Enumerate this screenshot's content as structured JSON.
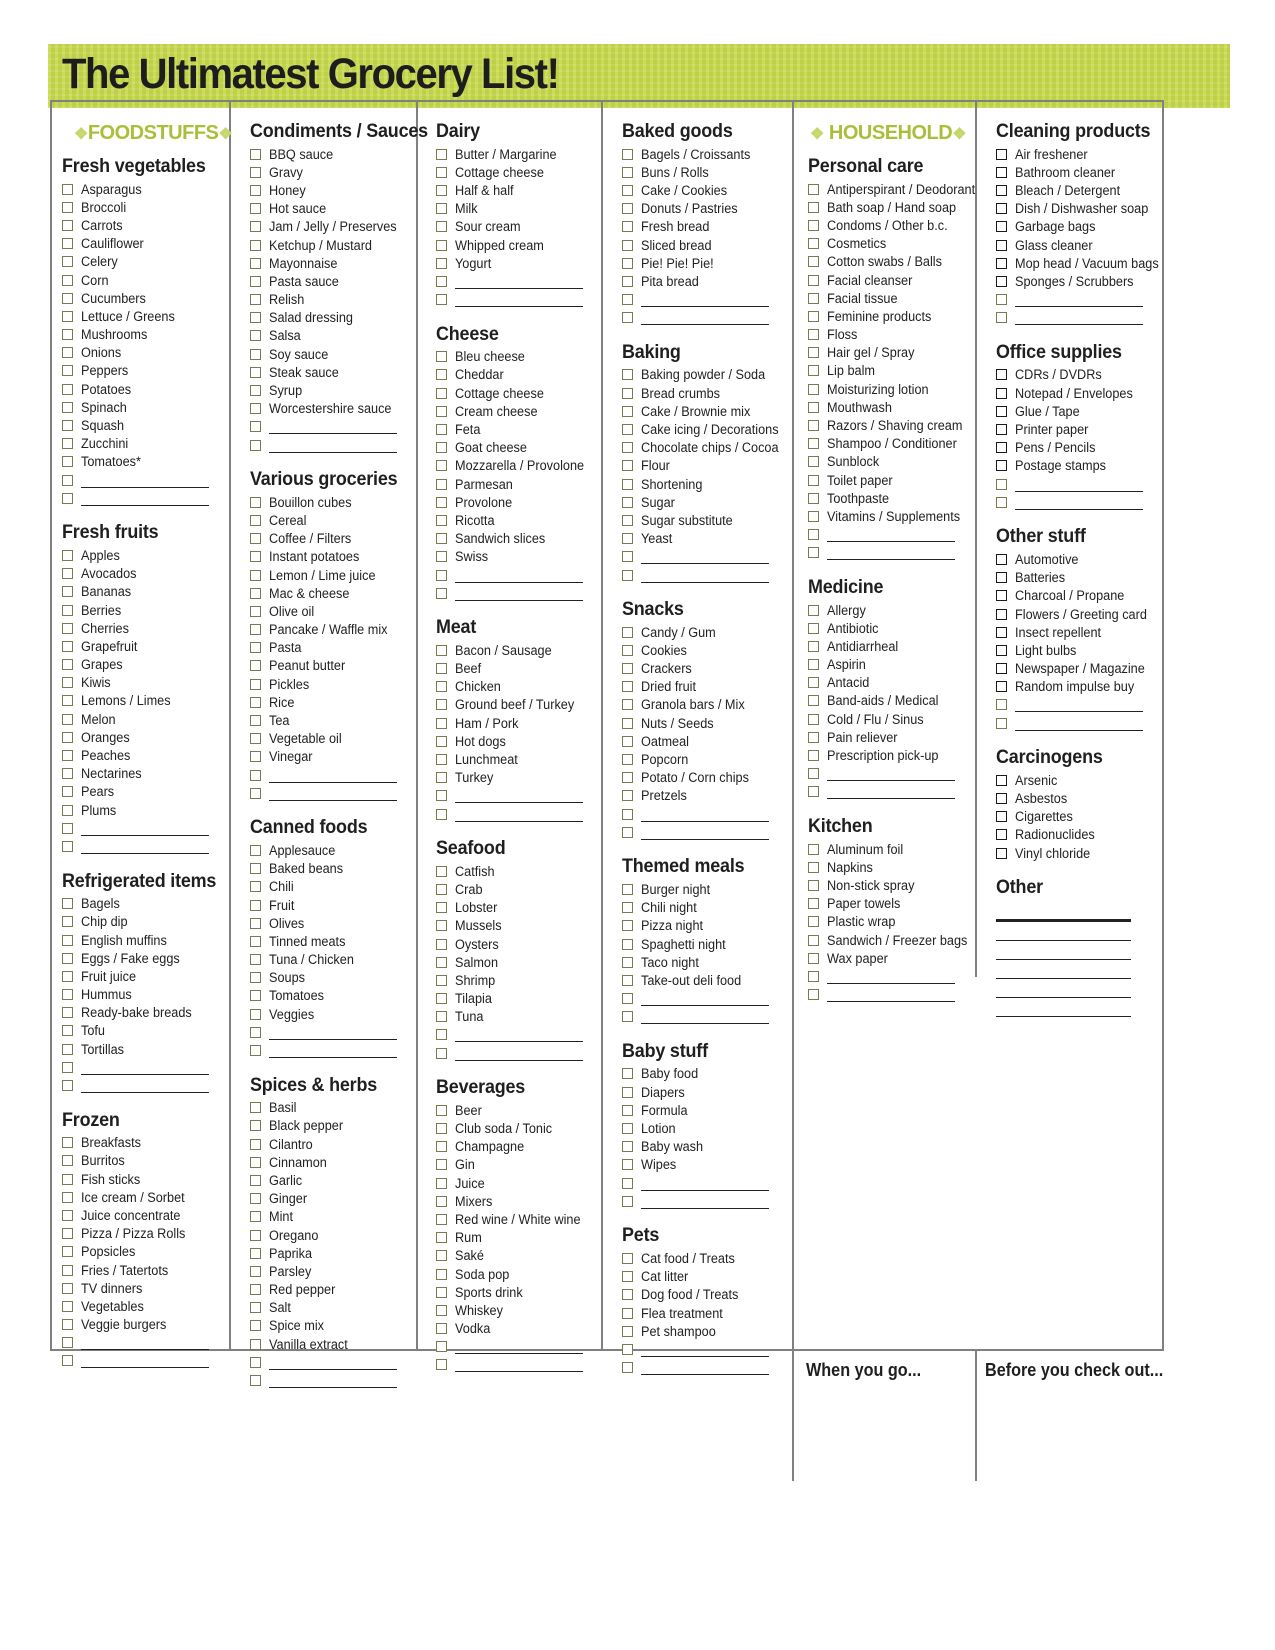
{
  "title": "The Ultimatest Grocery List!",
  "colors": {
    "accent": "#c5d84a",
    "brand_text": "#a9bf39",
    "rule": "#808080"
  },
  "foodstuffs": {
    "brand": "FOODSTUFFS",
    "ornament": "❖",
    "col1": [
      {
        "title": "Fresh vegetables",
        "items": [
          "Asparagus",
          "Broccoli",
          "Carrots",
          "Cauliflower",
          "Celery",
          "Corn",
          "Cucumbers",
          "Lettuce / Greens",
          "Mushrooms",
          "Onions",
          "Peppers",
          "Potatoes",
          "Spinach",
          "Squash",
          "Zucchini",
          "Tomatoes*"
        ],
        "blanks": 2
      },
      {
        "title": "Fresh fruits",
        "items": [
          "Apples",
          "Avocados",
          "Bananas",
          "Berries",
          "Cherries",
          "Grapefruit",
          "Grapes",
          "Kiwis",
          "Lemons / Limes",
          "Melon",
          "Oranges",
          "Peaches",
          "Nectarines",
          "Pears",
          "Plums"
        ],
        "blanks": 2
      },
      {
        "title": "Refrigerated items",
        "items": [
          "Bagels",
          "Chip dip",
          "English muffins",
          "Eggs / Fake eggs",
          "Fruit juice",
          "Hummus",
          "Ready-bake breads",
          "Tofu",
          "Tortillas"
        ],
        "blanks": 2
      },
      {
        "title": "Frozen",
        "items": [
          "Breakfasts",
          "Burritos",
          "Fish sticks",
          "Ice cream / Sorbet",
          "Juice concentrate",
          "Pizza / Pizza Rolls",
          "Popsicles",
          "Fries / Tatertots",
          "TV dinners",
          "Vegetables",
          "Veggie burgers"
        ],
        "blanks": 2
      }
    ],
    "col2": [
      {
        "title": "Condiments / Sauces",
        "items": [
          "BBQ sauce",
          "Gravy",
          "Honey",
          "Hot sauce",
          "Jam / Jelly / Preserves",
          "Ketchup / Mustard",
          "Mayonnaise",
          "Pasta sauce",
          "Relish",
          "Salad dressing",
          "Salsa",
          "Soy sauce",
          "Steak sauce",
          "Syrup",
          "Worcestershire sauce"
        ],
        "blanks": 2
      },
      {
        "title": "Various groceries",
        "items": [
          "Bouillon cubes",
          "Cereal",
          "Coffee / Filters",
          "Instant potatoes",
          "Lemon / Lime juice",
          "Mac & cheese",
          "Olive oil",
          "Pancake / Waffle mix",
          "Pasta",
          "Peanut butter",
          "Pickles",
          "Rice",
          "Tea",
          "Vegetable oil",
          "Vinegar"
        ],
        "blanks": 2
      },
      {
        "title": "Canned foods",
        "items": [
          "Applesauce",
          "Baked beans",
          "Chili",
          "Fruit",
          "Olives",
          "Tinned meats",
          "Tuna / Chicken",
          "Soups",
          "Tomatoes",
          "Veggies"
        ],
        "blanks": 2
      },
      {
        "title": "Spices & herbs",
        "items": [
          "Basil",
          "Black pepper",
          "Cilantro",
          "Cinnamon",
          "Garlic",
          "Ginger",
          "Mint",
          "Oregano",
          "Paprika",
          "Parsley",
          "Red pepper",
          "Salt",
          "Spice mix",
          "Vanilla extract"
        ],
        "blanks": 2
      }
    ],
    "col3": [
      {
        "title": "Dairy",
        "items": [
          "Butter / Margarine",
          "Cottage cheese",
          "Half & half",
          "Milk",
          "Sour cream",
          "Whipped cream",
          "Yogurt"
        ],
        "blanks": 2
      },
      {
        "title": "Cheese",
        "items": [
          "Bleu cheese",
          "Cheddar",
          "Cottage cheese",
          "Cream cheese",
          "Feta",
          "Goat cheese",
          "Mozzarella / Provolone",
          "Parmesan",
          "Provolone",
          "Ricotta",
          "Sandwich slices",
          "Swiss"
        ],
        "blanks": 2
      },
      {
        "title": "Meat",
        "items": [
          "Bacon / Sausage",
          "Beef",
          "Chicken",
          "Ground beef / Turkey",
          "Ham / Pork",
          "Hot dogs",
          "Lunchmeat",
          "Turkey"
        ],
        "blanks": 2
      },
      {
        "title": "Seafood",
        "items": [
          "Catfish",
          "Crab",
          "Lobster",
          "Mussels",
          "Oysters",
          "Salmon",
          "Shrimp",
          "Tilapia",
          "Tuna"
        ],
        "blanks": 2
      },
      {
        "title": "Beverages",
        "items": [
          "Beer",
          "Club soda / Tonic",
          "Champagne",
          "Gin",
          "Juice",
          "Mixers",
          "Red wine / White wine",
          "Rum",
          "Saké",
          "Soda pop",
          "Sports drink",
          "Whiskey",
          "Vodka"
        ],
        "blanks": 2
      }
    ],
    "col4": [
      {
        "title": "Baked goods",
        "items": [
          "Bagels / Croissants",
          "Buns / Rolls",
          "Cake / Cookies",
          "Donuts / Pastries",
          "Fresh bread",
          "Sliced bread",
          "Pie! Pie! Pie!",
          "Pita bread"
        ],
        "blanks": 2
      },
      {
        "title": "Baking",
        "items": [
          "Baking powder / Soda",
          "Bread crumbs",
          "Cake / Brownie mix",
          "Cake icing / Decorations",
          "Chocolate chips / Cocoa",
          "Flour",
          "Shortening",
          "Sugar",
          "Sugar substitute",
          "Yeast"
        ],
        "blanks": 2
      },
      {
        "title": "Snacks",
        "items": [
          "Candy / Gum",
          "Cookies",
          "Crackers",
          "Dried fruit",
          "Granola bars / Mix",
          "Nuts / Seeds",
          "Oatmeal",
          "Popcorn",
          "Potato / Corn chips",
          "Pretzels"
        ],
        "blanks": 2
      },
      {
        "title": "Themed meals",
        "items": [
          "Burger night",
          "Chili night",
          "Pizza night",
          "Spaghetti night",
          "Taco night",
          "Take-out deli food"
        ],
        "blanks": 2
      },
      {
        "title": "Baby stuff",
        "items": [
          "Baby food",
          "Diapers",
          "Formula",
          "Lotion",
          "Baby wash",
          "Wipes"
        ],
        "blanks": 2
      },
      {
        "title": "Pets",
        "items": [
          "Cat food / Treats",
          "Cat litter",
          "Dog food / Treats",
          "Flea treatment",
          "Pet shampoo"
        ],
        "blanks": 2
      }
    ]
  },
  "household": {
    "brand": "HOUSEHOLD",
    "ornament": "❖",
    "col5": [
      {
        "title": "Personal care",
        "items": [
          "Antiperspirant / Deodorant",
          "Bath soap / Hand soap",
          "Condoms / Other b.c.",
          "Cosmetics",
          "Cotton swabs / Balls",
          "Facial cleanser",
          "Facial tissue",
          "Feminine products",
          "Floss",
          "Hair gel / Spray",
          "Lip balm",
          "Moisturizing lotion",
          "Mouthwash",
          "Razors / Shaving cream",
          "Shampoo / Conditioner",
          "Sunblock",
          "Toilet paper",
          "Toothpaste",
          "Vitamins / Supplements"
        ],
        "blanks": 2
      },
      {
        "title": "Medicine",
        "items": [
          "Allergy",
          "Antibiotic",
          "Antidiarrheal",
          "Aspirin",
          "Antacid",
          "Band-aids / Medical",
          "Cold / Flu / Sinus",
          "Pain reliever",
          "Prescription pick-up"
        ],
        "blanks": 2
      },
      {
        "title": "Kitchen",
        "items": [
          "Aluminum foil",
          "Napkins",
          "Non-stick spray",
          "Paper towels",
          "Plastic wrap",
          "Sandwich / Freezer bags",
          "Wax paper"
        ],
        "blanks": 2
      }
    ],
    "col6": [
      {
        "title": "Cleaning products",
        "items": [
          "Air freshener",
          "Bathroom cleaner",
          "Bleach / Detergent",
          "Dish / Dishwasher soap",
          "Garbage bags",
          "Glass cleaner",
          "Mop head / Vacuum bags",
          "Sponges / Scrubbers"
        ],
        "blanks": 2
      },
      {
        "title": "Office supplies",
        "items": [
          "CDRs / DVDRs",
          "Notepad / Envelopes",
          "Glue / Tape",
          "Printer paper",
          "Pens / Pencils",
          "Postage stamps"
        ],
        "blanks": 2
      },
      {
        "title": "Other stuff",
        "items": [
          "Automotive",
          "Batteries",
          "Charcoal / Propane",
          "Flowers / Greeting card",
          "Insect repellent",
          "Light bulbs",
          "Newspaper / Magazine",
          "Random impulse buy"
        ],
        "blanks": 2
      },
      {
        "title": "Carcinogens",
        "items": [
          "Arsenic",
          "Asbestos",
          "Cigarettes",
          "Radionuclides",
          "Vinyl chloride"
        ],
        "blanks": 0
      }
    ],
    "other": {
      "title": "Other",
      "lines": 6
    }
  },
  "footer": {
    "when_you_go": "When you go...",
    "before_checkout": "Before you check out..."
  }
}
